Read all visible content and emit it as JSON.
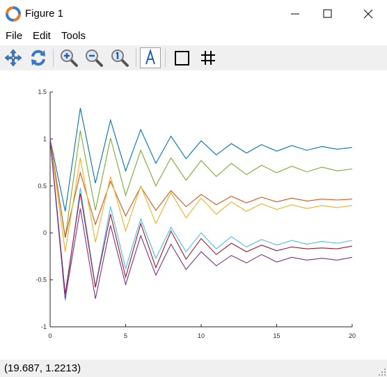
{
  "window": {
    "title": "Figure 1"
  },
  "menu": {
    "file": "File",
    "edit": "Edit",
    "tools": "Tools"
  },
  "toolbar": {
    "buttons": [
      "pan-icon",
      "rotate-icon",
      "zoom-in-icon",
      "zoom-out-icon",
      "zoom-reset-icon",
      "text-annotation-icon",
      "box-toggle-icon",
      "grid-toggle-icon"
    ]
  },
  "status": {
    "coordinates": "(19.687, 1.2213)"
  },
  "chart_data": {
    "type": "line",
    "x": [
      0,
      1,
      2,
      3,
      4,
      5,
      6,
      7,
      8,
      9,
      10,
      11,
      12,
      13,
      14,
      15,
      16,
      17,
      18,
      19,
      20
    ],
    "xlim": [
      0,
      20
    ],
    "ylim": [
      -1,
      1.5
    ],
    "xticks": [
      "0",
      "5",
      "10",
      "15",
      "20"
    ],
    "yticks": [
      "-1",
      "-0.5",
      "0",
      "0.5",
      "1",
      "1.5"
    ],
    "grid": false,
    "series": [
      {
        "color": "#0072bd",
        "values": [
          1,
          0.23,
          1.33,
          0.53,
          1.2,
          0.66,
          1.1,
          0.74,
          1.03,
          0.79,
          0.98,
          0.83,
          0.95,
          0.85,
          0.94,
          0.87,
          0.93,
          0.88,
          0.92,
          0.89,
          0.91
        ]
      },
      {
        "color": "#77ac30",
        "values": [
          1,
          -0.05,
          1.09,
          0.24,
          1.01,
          0.4,
          0.88,
          0.5,
          0.8,
          0.56,
          0.77,
          0.6,
          0.74,
          0.62,
          0.72,
          0.64,
          0.71,
          0.65,
          0.7,
          0.66,
          0.68
        ]
      },
      {
        "color": "#d95319",
        "values": [
          1,
          -0.05,
          0.64,
          0.09,
          0.55,
          0.18,
          0.49,
          0.24,
          0.45,
          0.28,
          0.41,
          0.3,
          0.39,
          0.32,
          0.38,
          0.33,
          0.37,
          0.34,
          0.36,
          0.35,
          0.36
        ]
      },
      {
        "color": "#edb120",
        "values": [
          1,
          -0.2,
          0.8,
          -0.1,
          0.6,
          0.02,
          0.5,
          0.1,
          0.43,
          0.16,
          0.37,
          0.2,
          0.33,
          0.23,
          0.31,
          0.25,
          0.3,
          0.26,
          0.29,
          0.27,
          0.29
        ]
      },
      {
        "color": "#4dbeee",
        "values": [
          1,
          -0.72,
          0.48,
          -0.57,
          0.28,
          -0.38,
          0.15,
          -0.27,
          0.06,
          -0.2,
          0.0,
          -0.17,
          -0.04,
          -0.15,
          -0.07,
          -0.13,
          -0.08,
          -0.12,
          -0.09,
          -0.11,
          -0.08
        ]
      },
      {
        "color": "#a2142f",
        "values": [
          1,
          -0.65,
          0.42,
          -0.58,
          0.2,
          -0.47,
          0.1,
          -0.37,
          0.02,
          -0.28,
          -0.06,
          -0.23,
          -0.11,
          -0.2,
          -0.13,
          -0.19,
          -0.15,
          -0.17,
          -0.16,
          -0.17,
          -0.14
        ]
      },
      {
        "color": "#7e2f8e",
        "values": [
          1,
          -0.7,
          0.26,
          -0.7,
          0.08,
          -0.55,
          -0.03,
          -0.45,
          -0.12,
          -0.39,
          -0.2,
          -0.35,
          -0.24,
          -0.32,
          -0.23,
          -0.31,
          -0.26,
          -0.29,
          -0.27,
          -0.29,
          -0.26
        ]
      }
    ]
  }
}
